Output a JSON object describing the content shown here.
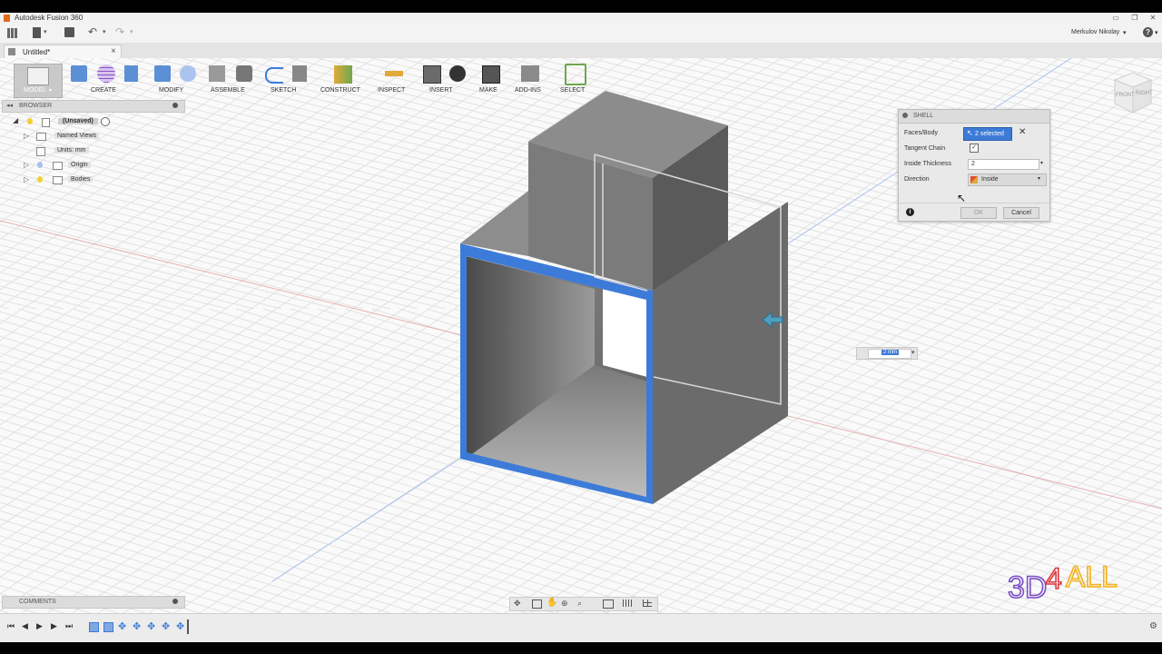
{
  "app": {
    "title": "Autodesk Fusion 360",
    "user": "Merkulov Nikolay",
    "help": "?"
  },
  "tab": {
    "label": "Untitled*",
    "close": "×"
  },
  "workspace": {
    "label": "MODEL"
  },
  "toolbar": {
    "groups": [
      "CREATE",
      "MODIFY",
      "ASSEMBLE",
      "SKETCH",
      "CONSTRUCT",
      "INSPECT",
      "INSERT",
      "MAKE",
      "ADD-INS",
      "SELECT"
    ]
  },
  "viewcube": {
    "front": "FRONT",
    "right": "RIGHT"
  },
  "browser": {
    "title": "BROWSER",
    "root": "(Unsaved)",
    "items": [
      "Named Views",
      "Units: mm",
      "Origin",
      "Bodies"
    ]
  },
  "dialog": {
    "title": "SHELL",
    "faces_label": "Faces/Body",
    "faces_value": "2 selected",
    "tangent_label": "Tangent Chain",
    "thickness_label": "Inside Thickness",
    "thickness_value": "2",
    "direction_label": "Direction",
    "direction_value": "Inside",
    "ok": "OK",
    "cancel": "Cancel"
  },
  "viewport_input": {
    "value": "2 mm"
  },
  "comments": {
    "title": "COMMENTS"
  },
  "watermark": {
    "text": "3D4ALL"
  },
  "colors": {
    "accent": "#3d7bd8",
    "body": "#6f6f6f",
    "grid": "#dedede",
    "red_axis": "#e5a3a3",
    "blue_axis": "#9fb8e8"
  }
}
